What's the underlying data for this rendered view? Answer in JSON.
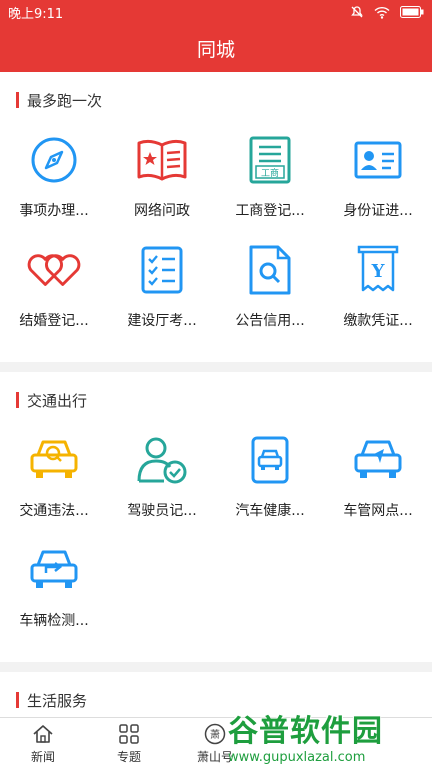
{
  "status_bar": {
    "time": "晚上9:11"
  },
  "title": "同城",
  "colors": {
    "accent": "#e53935",
    "icon_blue": "#2196f3",
    "icon_red": "#e53935",
    "icon_teal": "#26a69a",
    "icon_yellow": "#f5b300"
  },
  "sections": [
    {
      "title": "最多跑一次",
      "items": [
        {
          "label": "事项办理...",
          "icon": "compass-icon"
        },
        {
          "label": "网络问政",
          "icon": "open-book-icon"
        },
        {
          "label": "工商登记...",
          "icon": "business-register-icon"
        },
        {
          "label": "身份证进...",
          "icon": "id-card-icon"
        },
        {
          "label": "结婚登记...",
          "icon": "double-heart-icon"
        },
        {
          "label": "建设厅考...",
          "icon": "checklist-icon"
        },
        {
          "label": "公告信用...",
          "icon": "document-search-icon"
        },
        {
          "label": "缴款凭证...",
          "icon": "receipt-icon"
        }
      ]
    },
    {
      "title": "交通出行",
      "items": [
        {
          "label": "交通违法...",
          "icon": "car-search-icon"
        },
        {
          "label": "驾驶员记...",
          "icon": "driver-check-icon"
        },
        {
          "label": "汽车健康...",
          "icon": "car-card-icon"
        },
        {
          "label": "车管网点...",
          "icon": "car-navigate-icon"
        },
        {
          "label": "车辆检测...",
          "icon": "car-forward-icon"
        }
      ]
    },
    {
      "title": "生活服务",
      "items": []
    }
  ],
  "tabs": [
    {
      "label": "新闻",
      "icon": "home-icon"
    },
    {
      "label": "专题",
      "icon": "grid-icon"
    },
    {
      "label": "萧山号",
      "icon": "xiao-badge-icon"
    }
  ],
  "watermark": {
    "brand": "谷普软件园",
    "url": "www.gupuxlazal.com"
  }
}
